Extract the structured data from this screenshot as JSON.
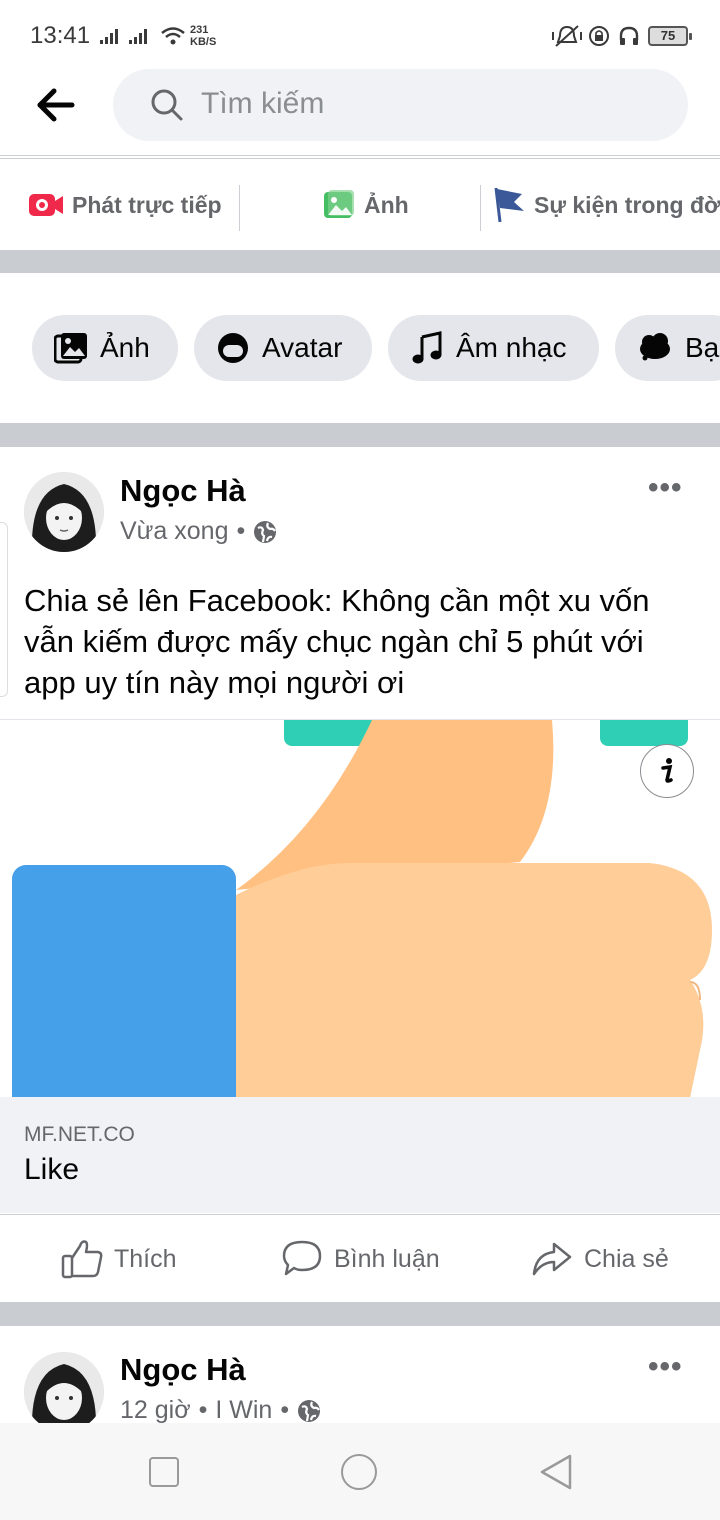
{
  "status_bar": {
    "time": "13:41",
    "net_speed_value": "231",
    "net_speed_unit": "KB/S",
    "battery": "75"
  },
  "search": {
    "placeholder": "Tìm kiếm"
  },
  "post_actions": [
    {
      "label": "Phát trực tiếp",
      "icon": "live-video-icon",
      "color": "#f02849"
    },
    {
      "label": "Ảnh",
      "icon": "photo-icon",
      "color": "#45bd62"
    },
    {
      "label": "Sự kiện trong đời",
      "icon": "flag-icon",
      "color": "#3b5998"
    }
  ],
  "chips": [
    {
      "label": "Ảnh",
      "icon": "photo-icon"
    },
    {
      "label": "Avatar",
      "icon": "avatar-icon"
    },
    {
      "label": "Âm nhạc",
      "icon": "music-note-icon"
    },
    {
      "label": "Bạ",
      "icon": "cloud-icon"
    }
  ],
  "post1": {
    "author": "Ngọc Hà",
    "time": "Vừa xong",
    "privacy_icon": "globe-icon",
    "text": "Chia sẻ lên Facebook: Không cần một xu vốn vẫn kiếm được mấy chục ngàn chỉ 5 phút với app uy tín này mọi người ơi",
    "link": {
      "domain": "MF.NET.CO",
      "title": "Like"
    },
    "image_icon": "thumbs-up-illustration",
    "info_icon": "info-icon"
  },
  "reactions": [
    {
      "label": "Thích",
      "icon": "like-icon"
    },
    {
      "label": "Bình luận",
      "icon": "comment-icon"
    },
    {
      "label": "Chia sẻ",
      "icon": "share-icon"
    }
  ],
  "post2": {
    "author": "Ngọc Hà",
    "time": "12 giờ",
    "group": "I Win",
    "privacy_icon": "globe-icon"
  },
  "colors": {
    "accent": "#1877f2",
    "secondary_text": "#65676b",
    "divider": "#c9ccd1",
    "chip_bg": "#e4e6eb"
  }
}
